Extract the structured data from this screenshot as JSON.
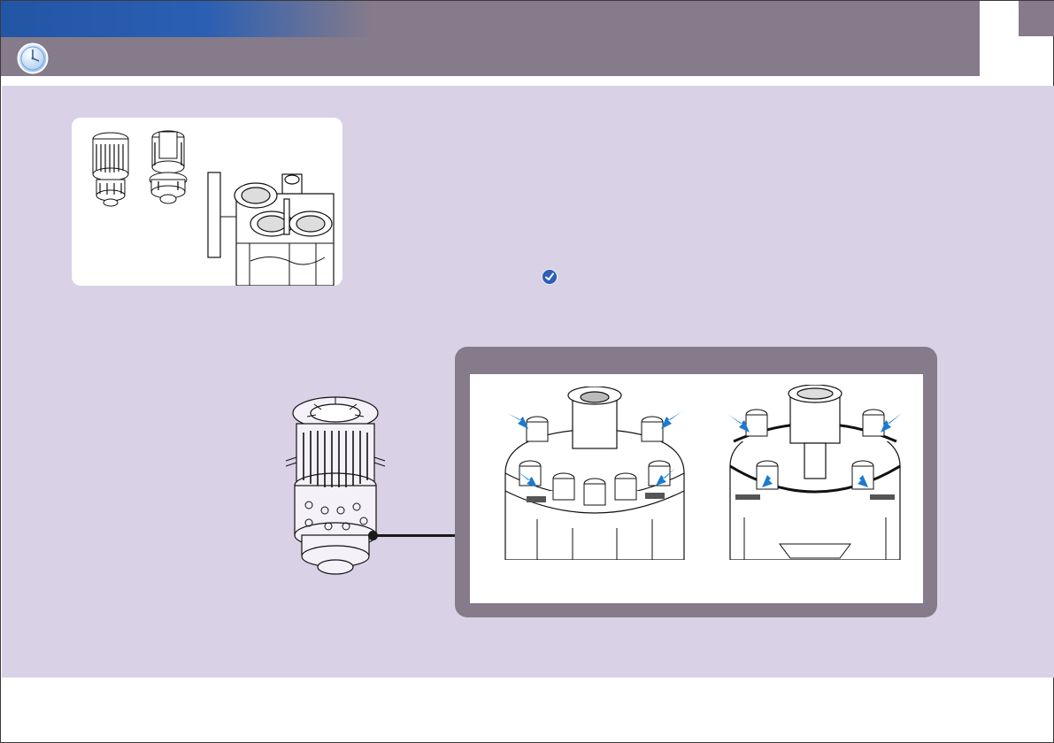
{
  "header": {
    "icon": "clock-icon",
    "colors": {
      "bar": "#857b8b",
      "accent_gradient": "#2355a6",
      "content_bg": "#d9d1e6"
    }
  },
  "thumbnails": {
    "items": [
      "filter-head-thumbnail",
      "inner-filter-thumbnail",
      "machine-assembly-thumbnail"
    ]
  },
  "check_marker": {
    "icon": "check-circle-icon",
    "color": "#2e5fb7"
  },
  "main_illustration": {
    "icon": "filter-assembly-illustration"
  },
  "detail_panel": {
    "images": [
      "detail-view-left",
      "detail-view-right"
    ],
    "arrow_color": "#1a7bd1",
    "arrows_per_view": 4
  }
}
